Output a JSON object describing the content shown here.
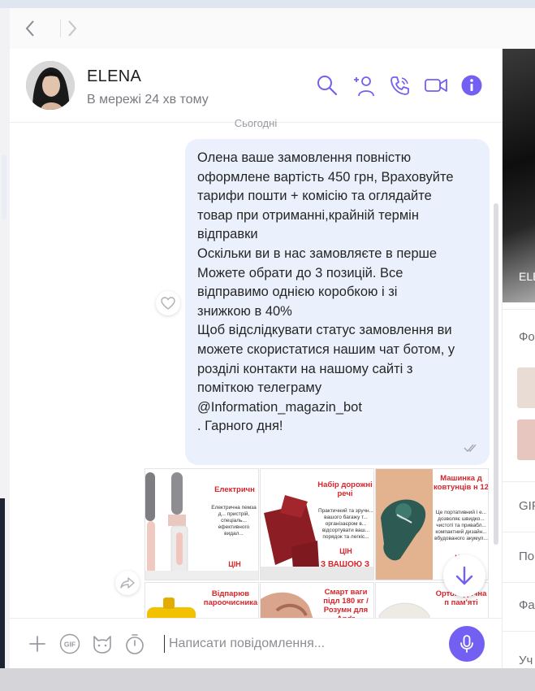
{
  "nav": {
    "back_icon": "chevron-left-icon",
    "forward_icon": "chevron-right-icon"
  },
  "contact": {
    "name": "ELENA",
    "status": "В мережі 24 хв тому"
  },
  "header_actions": [
    {
      "name": "search-icon"
    },
    {
      "name": "add-participant-icon"
    },
    {
      "name": "call-icon"
    },
    {
      "name": "video-call-icon"
    },
    {
      "name": "info-icon"
    }
  ],
  "colors": {
    "accent": "#7360f2",
    "bubble": "#eaf1fc",
    "promo_red": "#d9242a"
  },
  "chat": {
    "day_divider": "Сьогодні",
    "message": {
      "text": "Олена ваше замовлення повністю\nоформлене вартість 450 грн, Враховуйте\nтарифи пошти + комісію  та оглядайте\nтовар при отриманні,крайній термін\nвідправки\nОскільки ви в нас замовляєте в перше\nМожете обрати до 3 позицій. Все\nвідправимо однією коробкою і зі\nзнижкою в 40%\nЩоб відслідкувати статус замовлення ви\nможете скористатися нашим чат ботом, у\nрозділі контакти на нашому сайті з\nпоміткою телеграму\n@Information_magazin_bot\n. Гарного дня!",
      "status_icon": "read-check-icon"
    },
    "gallery": [
      {
        "title": "Електричн",
        "desc": "Електрична пемза д... пристрій, спеціаль... ефективного видал...",
        "price": "ЦІН"
      },
      {
        "title": "Набір дорожні речі",
        "desc": "Практичний та зручн... вашого багажу т... організаєром в... відсортувати ваш... порядок та легкіс...",
        "price": "ЦІН",
        "ribbon": "З ВАШОЮ З"
      },
      {
        "title": "Машинка д ковтунців н 12",
        "desc": "Це портативний і е... дозволяє швидко... чистоті та привабл... компактний дизайн... вбудованого акумул...",
        "price": "ЦІН"
      },
      {
        "title": "Відпарюв пароочисника",
        "desc": "",
        "price": ""
      },
      {
        "title": "Смарт ваги підл 180 кг / Розумн для Andr",
        "desc": "",
        "price": ""
      },
      {
        "title": "Ортопедична п пам'яті",
        "desc": "",
        "price": ""
      }
    ]
  },
  "composer": {
    "placeholder": "Написати повідомлення...",
    "icons": [
      "plus-icon",
      "gif-icon",
      "sticker-icon",
      "timer-icon",
      "microphone-icon"
    ]
  },
  "right_panel": {
    "name_fragment": "ELE",
    "labels": [
      "Фо",
      "GIF",
      "По",
      "Фа",
      "Уч"
    ]
  }
}
